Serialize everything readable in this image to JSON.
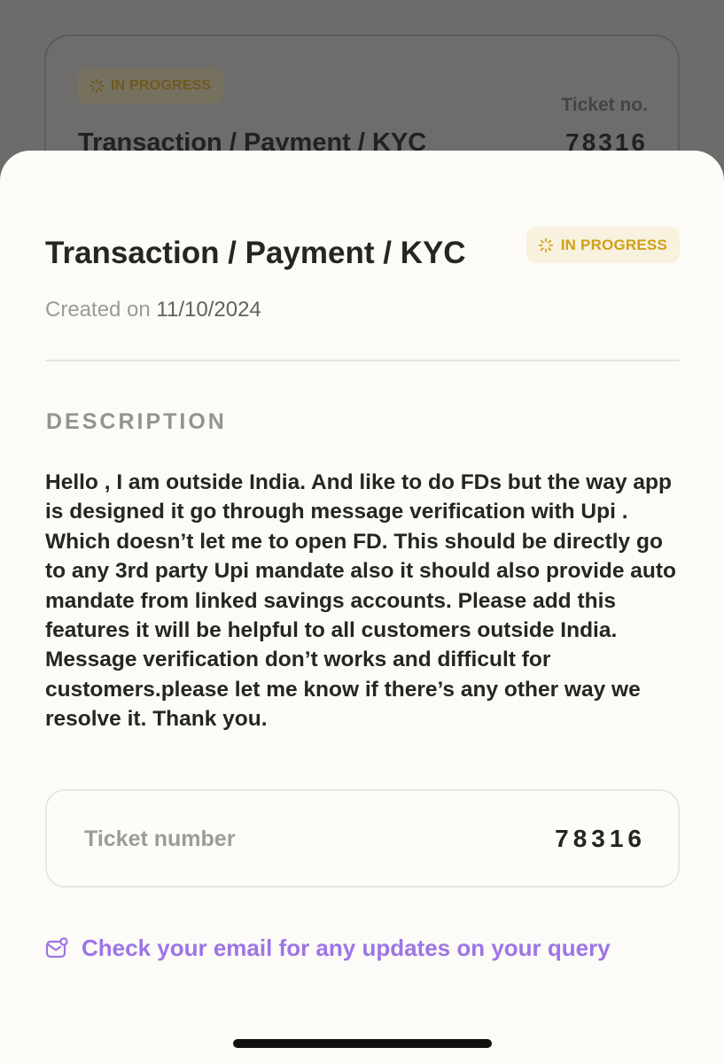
{
  "background_card": {
    "status_label": "IN PROGRESS",
    "title": "Transaction / Payment / KYC",
    "ticket_label": "Ticket no.",
    "ticket_number": "78316"
  },
  "sheet": {
    "title": "Transaction / Payment / KYC",
    "status_label": "IN PROGRESS",
    "created_prefix": "Created on ",
    "created_date": "11/10/2024",
    "description_heading": "DESCRIPTION",
    "description": "Hello , I am outside India. And like to do FDs but the way app is designed it go through message verification with Upi . Which doesn’t let me to open FD. This should be directly go to any 3rd party Upi mandate also it should also provide auto mandate from linked savings accounts. Please add this features it will be helpful to all customers outside India. Message verification don’t works and difficult for customers.please let me know if there’s any other way we resolve it. Thank you.",
    "ticket_label": "Ticket number",
    "ticket_number": "78316",
    "email_note": "Check your email for any updates on your query"
  },
  "icons": {
    "status": "spinner-icon",
    "email": "mail-icon"
  },
  "colors": {
    "status_text": "#d1a016",
    "status_bg": "#f8f1de",
    "link": "#9d75e6",
    "sheet_bg": "#fcfbf7",
    "scrim": "#6d6c6a"
  }
}
